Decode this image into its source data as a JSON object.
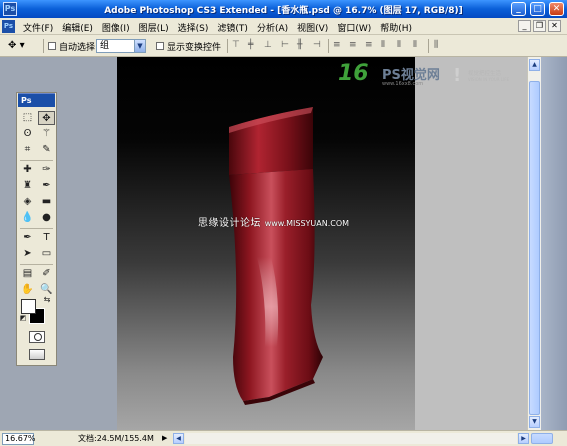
{
  "window": {
    "title": "Adobe Photoshop CS3 Extended - [香水瓶.psd @ 16.7% (图层 17, RGB/8)]",
    "app_icon_text": "Ps",
    "minimize": "_",
    "maximize": "□",
    "close": "✕"
  },
  "menu": {
    "items": [
      "文件(F)",
      "编辑(E)",
      "图像(I)",
      "图层(L)",
      "选择(S)",
      "滤镜(T)",
      "分析(A)",
      "视图(V)",
      "窗口(W)",
      "帮助(H)"
    ],
    "doc_minimize": "_",
    "doc_restore": "❐",
    "doc_close": "✕"
  },
  "options": {
    "tool_glyph": "✥",
    "auto_select_label": "自动选择:",
    "auto_select_value": "组",
    "show_transform_label": "显示变换控件",
    "align_icons": [
      "align-top-icon",
      "align-vcenter-icon",
      "align-bottom-icon",
      "align-left-icon",
      "align-hcenter-icon",
      "align-right-icon",
      "distribute-top-icon",
      "distribute-vcenter-icon",
      "distribute-bottom-icon",
      "distribute-left-icon",
      "distribute-hcenter-icon",
      "distribute-right-icon",
      "auto-align-icon"
    ]
  },
  "tools": {
    "header": "Ps",
    "foreground_color": "#ffffff",
    "background_color": "#000000"
  },
  "watermark": {
    "logo_16": "16",
    "brand": "PS视觉网",
    "url": "www.16xx8.com",
    "slogan": "视觉把控生活",
    "slogan_en": "VISION IN YOUR LIFE",
    "center_cn": "思缘设计论坛",
    "center_url": "www.MISSYUAN.COM"
  },
  "status": {
    "zoom": "16.67%",
    "doc_size": "文档:24.5M/155.4M",
    "arrow": "▶"
  },
  "colors": {
    "bottle_red": "#8a1620",
    "titlebar_blue": "#0a5fd8",
    "panel_bg": "#ece9d8"
  }
}
